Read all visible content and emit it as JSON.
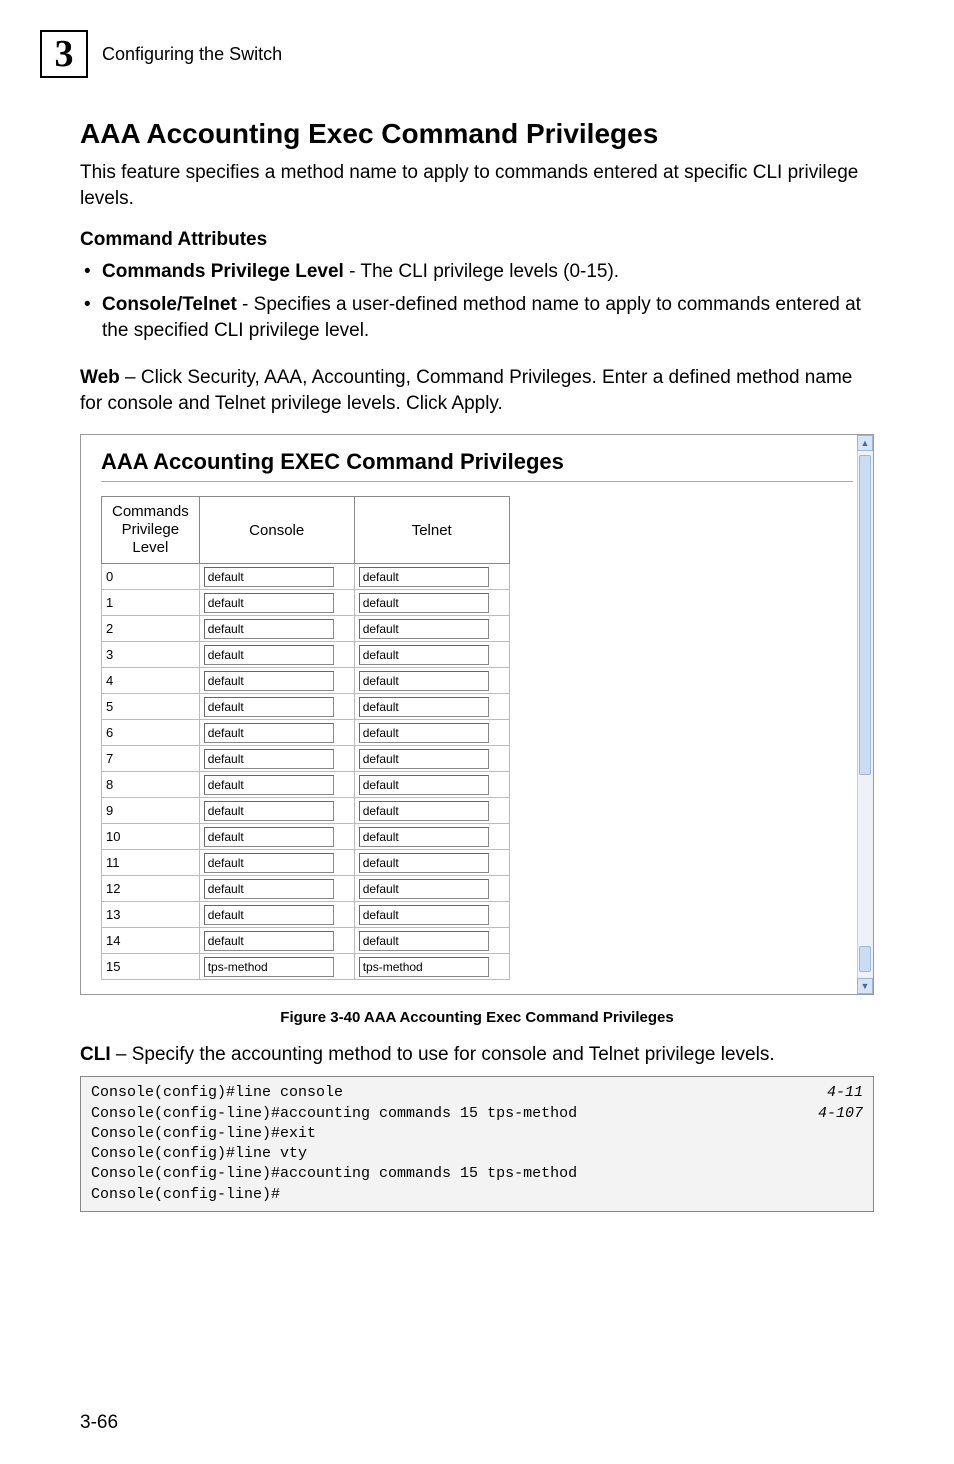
{
  "header": {
    "chapter_number": "3",
    "chapter_title": "Configuring the Switch"
  },
  "h1": "AAA Accounting Exec Command Privileges",
  "intro": "This feature specifies a method name to apply to commands entered at specific CLI privilege levels.",
  "attr_heading": "Command Attributes",
  "bullets": [
    {
      "label": "Commands Privilege Level",
      "rest": " - The CLI privilege levels (0-15)."
    },
    {
      "label": "Console/Telnet",
      "rest": " - Specifies a user-defined method name to apply to commands entered at the specified CLI privilege level."
    }
  ],
  "web_label": "Web",
  "web_text": " – Click Security, AAA, Accounting, Command Privileges. Enter a defined method name for console and Telnet privilege levels. Click Apply.",
  "screenshot": {
    "title": "AAA Accounting EXEC Command Privileges",
    "headers": {
      "c0": "Commands Privilege Level",
      "c1": "Console",
      "c2": "Telnet"
    },
    "rows": [
      {
        "level": "0",
        "console": "default",
        "telnet": "default"
      },
      {
        "level": "1",
        "console": "default",
        "telnet": "default"
      },
      {
        "level": "2",
        "console": "default",
        "telnet": "default"
      },
      {
        "level": "3",
        "console": "default",
        "telnet": "default"
      },
      {
        "level": "4",
        "console": "default",
        "telnet": "default"
      },
      {
        "level": "5",
        "console": "default",
        "telnet": "default"
      },
      {
        "level": "6",
        "console": "default",
        "telnet": "default"
      },
      {
        "level": "7",
        "console": "default",
        "telnet": "default"
      },
      {
        "level": "8",
        "console": "default",
        "telnet": "default"
      },
      {
        "level": "9",
        "console": "default",
        "telnet": "default"
      },
      {
        "level": "10",
        "console": "default",
        "telnet": "default"
      },
      {
        "level": "11",
        "console": "default",
        "telnet": "default"
      },
      {
        "level": "12",
        "console": "default",
        "telnet": "default"
      },
      {
        "level": "13",
        "console": "default",
        "telnet": "default"
      },
      {
        "level": "14",
        "console": "default",
        "telnet": "default"
      },
      {
        "level": "15",
        "console": "tps-method",
        "telnet": "tps-method"
      }
    ]
  },
  "figure_caption": "Figure 3-40  AAA Accounting Exec Command Privileges",
  "cli_label": "CLI",
  "cli_text": " – Specify the accounting method to use for console and Telnet privilege levels.",
  "cli_lines": [
    {
      "cmd": "Console(config)#line console",
      "ref": "4-11"
    },
    {
      "cmd": "Console(config-line)#accounting commands 15 tps-method",
      "ref": "4-107"
    },
    {
      "cmd": "Console(config-line)#exit",
      "ref": ""
    },
    {
      "cmd": "Console(config)#line vty",
      "ref": ""
    },
    {
      "cmd": "Console(config-line)#accounting commands 15 tps-method",
      "ref": ""
    },
    {
      "cmd": "Console(config-line)#",
      "ref": ""
    }
  ],
  "page_number": "3-66"
}
